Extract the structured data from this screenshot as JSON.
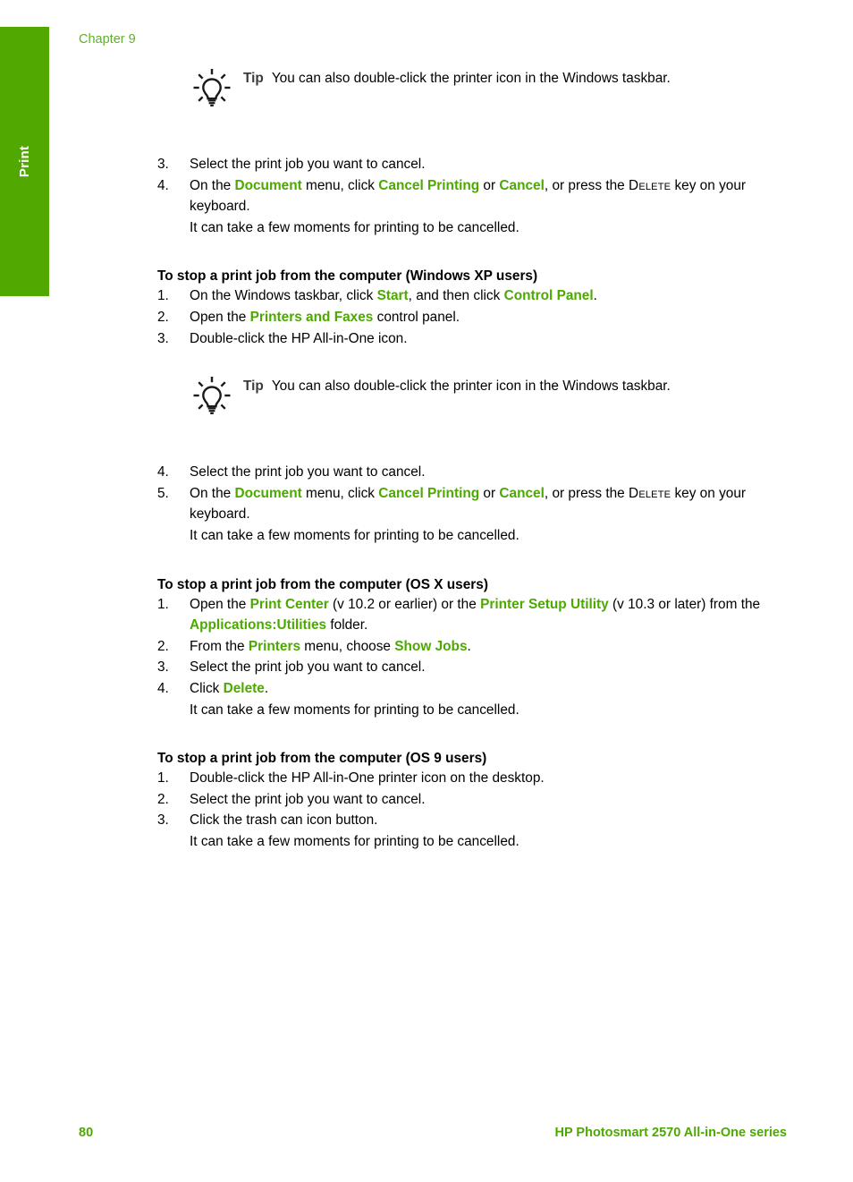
{
  "sidebar": {
    "tab_label": "Print",
    "color": "#51a800"
  },
  "header": {
    "chapter": "Chapter 9",
    "chapter_color": "#5fb02a"
  },
  "colors": {
    "ui_green": "#4ca900",
    "tab_green": "#51a800",
    "tip_label": "#3b3b3b"
  },
  "tips": {
    "label": "Tip",
    "icon": "lightbulb-icon",
    "text": "You can also double-click the printer icon in the Windows taskbar."
  },
  "top_steps": {
    "items": [
      {
        "num": "3.",
        "lines": [
          {
            "segs": [
              {
                "t": "Select the print job you want to cancel.",
                "style": "plain"
              }
            ]
          }
        ]
      },
      {
        "num": "4.",
        "lines": [
          {
            "segs": [
              {
                "t": "On the ",
                "style": "plain"
              },
              {
                "t": "Document",
                "style": "ui"
              },
              {
                "t": " menu, click ",
                "style": "plain"
              },
              {
                "t": "Cancel Printing",
                "style": "ui"
              },
              {
                "t": " or ",
                "style": "plain"
              },
              {
                "t": "Cancel",
                "style": "ui"
              },
              {
                "t": ", or press the ",
                "style": "plain"
              },
              {
                "t": "Delete",
                "style": "smallcaps"
              },
              {
                "t": " key on your keyboard.",
                "style": "plain"
              }
            ]
          },
          {
            "segs": [
              {
                "t": "It can take a few moments for printing to be cancelled.",
                "style": "plain"
              }
            ]
          }
        ]
      }
    ]
  },
  "sections": [
    {
      "heading": "To stop a print job from the computer (Windows XP users)",
      "items": [
        {
          "num": "1.",
          "lines": [
            {
              "segs": [
                {
                  "t": "On the Windows taskbar, click ",
                  "style": "plain"
                },
                {
                  "t": "Start",
                  "style": "ui"
                },
                {
                  "t": ", and then click ",
                  "style": "plain"
                },
                {
                  "t": "Control Panel",
                  "style": "ui"
                },
                {
                  "t": ".",
                  "style": "plain"
                }
              ]
            }
          ]
        },
        {
          "num": "2.",
          "lines": [
            {
              "segs": [
                {
                  "t": "Open the ",
                  "style": "plain"
                },
                {
                  "t": "Printers and Faxes",
                  "style": "ui"
                },
                {
                  "t": " control panel.",
                  "style": "plain"
                }
              ]
            }
          ]
        },
        {
          "num": "3.",
          "lines": [
            {
              "segs": [
                {
                  "t": "Double-click the HP All-in-One icon.",
                  "style": "plain"
                }
              ]
            }
          ]
        }
      ],
      "tip_after": true,
      "items_after": [
        {
          "num": "4.",
          "lines": [
            {
              "segs": [
                {
                  "t": "Select the print job you want to cancel.",
                  "style": "plain"
                }
              ]
            }
          ]
        },
        {
          "num": "5.",
          "lines": [
            {
              "segs": [
                {
                  "t": "On the ",
                  "style": "plain"
                },
                {
                  "t": "Document",
                  "style": "ui"
                },
                {
                  "t": " menu, click ",
                  "style": "plain"
                },
                {
                  "t": "Cancel Printing",
                  "style": "ui"
                },
                {
                  "t": " or ",
                  "style": "plain"
                },
                {
                  "t": "Cancel",
                  "style": "ui"
                },
                {
                  "t": ", or press the ",
                  "style": "plain"
                },
                {
                  "t": "Delete",
                  "style": "smallcaps"
                },
                {
                  "t": " key on your keyboard.",
                  "style": "plain"
                }
              ]
            },
            {
              "segs": [
                {
                  "t": "It can take a few moments for printing to be cancelled.",
                  "style": "plain"
                }
              ]
            }
          ]
        }
      ]
    },
    {
      "heading": "To stop a print job from the computer (OS X users)",
      "items": [
        {
          "num": "1.",
          "lines": [
            {
              "segs": [
                {
                  "t": "Open the ",
                  "style": "plain"
                },
                {
                  "t": "Print Center",
                  "style": "ui"
                },
                {
                  "t": " (v 10.2 or earlier) or the ",
                  "style": "plain"
                },
                {
                  "t": "Printer Setup Utility",
                  "style": "ui"
                },
                {
                  "t": " (v 10.3 or later) from the ",
                  "style": "plain"
                },
                {
                  "t": "Applications:Utilities",
                  "style": "ui"
                },
                {
                  "t": " folder.",
                  "style": "plain"
                }
              ]
            }
          ]
        },
        {
          "num": "2.",
          "lines": [
            {
              "segs": [
                {
                  "t": "From the ",
                  "style": "plain"
                },
                {
                  "t": "Printers",
                  "style": "ui"
                },
                {
                  "t": " menu, choose ",
                  "style": "plain"
                },
                {
                  "t": "Show Jobs",
                  "style": "ui"
                },
                {
                  "t": ".",
                  "style": "plain"
                }
              ]
            }
          ]
        },
        {
          "num": "3.",
          "lines": [
            {
              "segs": [
                {
                  "t": "Select the print job you want to cancel.",
                  "style": "plain"
                }
              ]
            }
          ]
        },
        {
          "num": "4.",
          "lines": [
            {
              "segs": [
                {
                  "t": "Click ",
                  "style": "plain"
                },
                {
                  "t": "Delete",
                  "style": "ui"
                },
                {
                  "t": ".",
                  "style": "plain"
                }
              ]
            },
            {
              "segs": [
                {
                  "t": "It can take a few moments for printing to be cancelled.",
                  "style": "plain"
                }
              ]
            }
          ]
        }
      ],
      "tip_after": false,
      "items_after": []
    },
    {
      "heading": "To stop a print job from the computer (OS 9 users)",
      "items": [
        {
          "num": "1.",
          "lines": [
            {
              "segs": [
                {
                  "t": "Double-click the HP All-in-One printer icon on the desktop.",
                  "style": "plain"
                }
              ]
            }
          ]
        },
        {
          "num": "2.",
          "lines": [
            {
              "segs": [
                {
                  "t": "Select the print job you want to cancel.",
                  "style": "plain"
                }
              ]
            }
          ]
        },
        {
          "num": "3.",
          "lines": [
            {
              "segs": [
                {
                  "t": "Click the trash can icon button.",
                  "style": "plain"
                }
              ]
            },
            {
              "segs": [
                {
                  "t": "It can take a few moments for printing to be cancelled.",
                  "style": "plain"
                }
              ]
            }
          ]
        }
      ],
      "tip_after": false,
      "items_after": []
    }
  ],
  "footer": {
    "page_number": "80",
    "book_title": "HP Photosmart 2570 All-in-One series"
  }
}
